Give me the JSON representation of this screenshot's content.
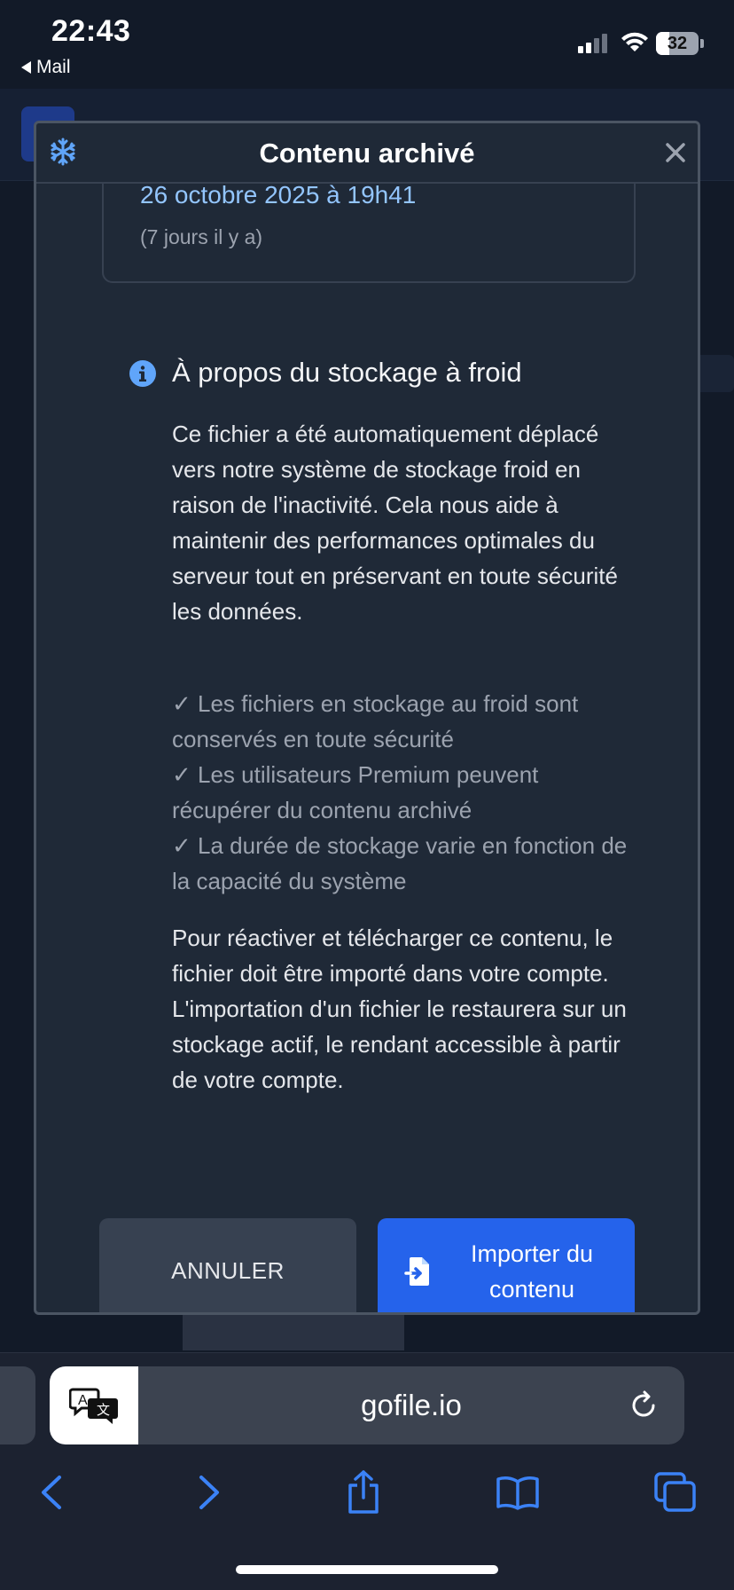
{
  "status_bar": {
    "time": "22:43",
    "back_label": "Mail",
    "battery": "32"
  },
  "modal": {
    "title": "Contenu archivé",
    "date_value": "26 octobre 2025 à 19h41",
    "date_relative": "(7 jours il y a)",
    "about_title": "À propos du stockage à froid",
    "paragraph1": "Ce fichier a été automatiquement déplacé vers notre système de stockage froid en raison de l'inactivité. Cela nous aide à maintenir des performances optimales du serveur tout en préservant en toute sécurité les données.",
    "checks": [
      "✓ Les fichiers en stockage au froid sont conservés en toute sécurité",
      "✓ Les utilisateurs Premium peuvent récupérer du contenu archivé",
      "✓ La durée de stockage varie en fonction de la capacité du système"
    ],
    "paragraph2": "Pour réactiver et télécharger ce contenu, le fichier doit être importé dans votre compte. L'importation d'un fichier le restaurera sur un stockage actif, le rendant accessible à partir de votre compte.",
    "cancel_label": "ANNULER",
    "import_label": "Importer du contenu"
  },
  "browser": {
    "url": "gofile.io"
  },
  "colors": {
    "accent": "#2563eb",
    "link": "#93c5fd",
    "modal_bg": "#1f2937"
  },
  "icons": {
    "modal_header": "snowflake-icon",
    "close": "close-icon",
    "info": "info-icon",
    "import": "file-import-icon",
    "translate": "translate-icon",
    "reload": "reload-icon"
  }
}
